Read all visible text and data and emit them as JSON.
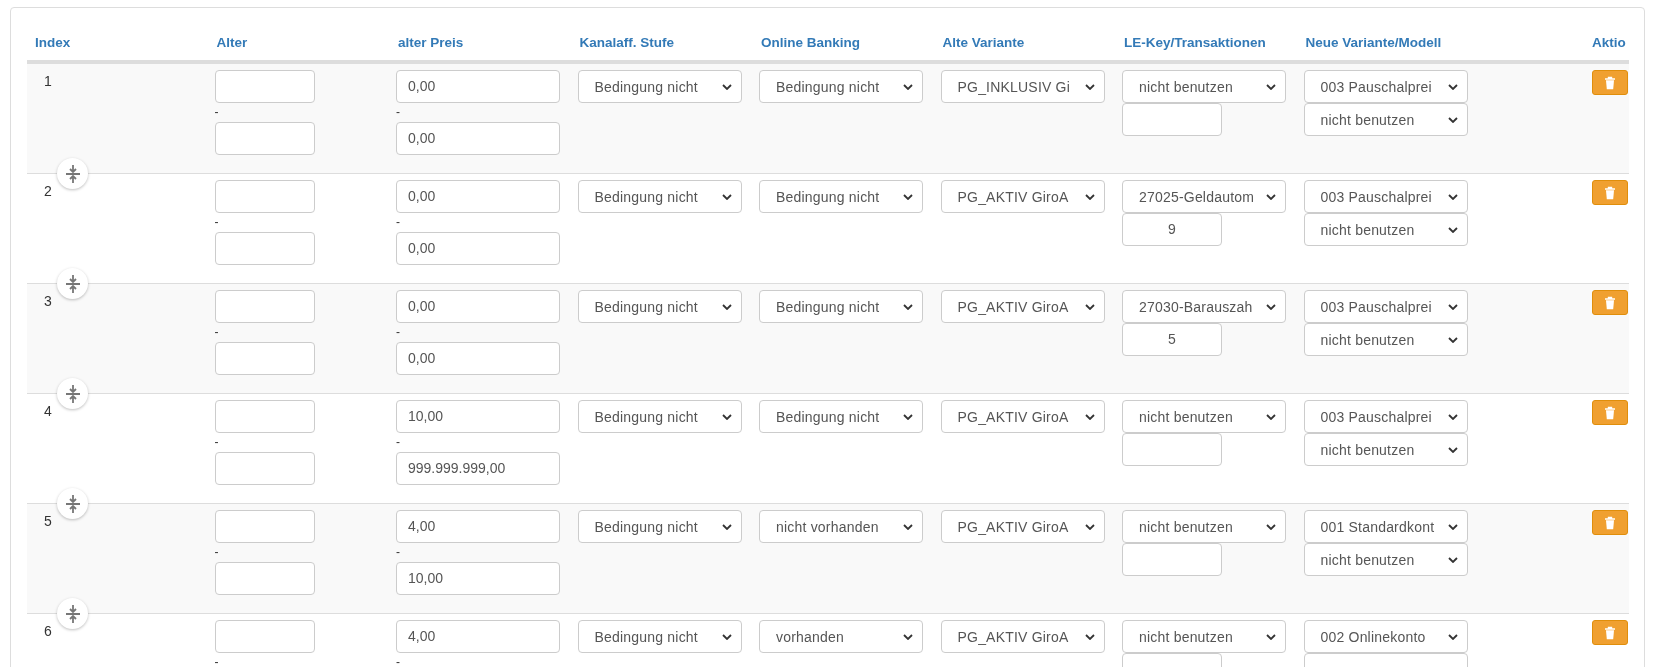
{
  "columns": [
    "Index",
    "Alter",
    "alter Preis",
    "Kanalaff. Stufe",
    "Online Banking",
    "Alte Variante",
    "LE-Key/Transaktionen",
    "Neue Variante/Modell",
    "Aktio"
  ],
  "rows": [
    {
      "index": "1",
      "alter_sep": "-",
      "preis_sep": "-",
      "preis_from": "0,00",
      "preis_to": "0,00",
      "kanalaff": "Bedingung nicht",
      "online_banking": "Bedingung nicht",
      "alte_variante": "PG_INKLUSIV Gi",
      "le_key": "nicht benutzen",
      "neue_variante": "003 Pauschalprei",
      "modell": "nicht benutzen"
    },
    {
      "index": "2",
      "alter_sep": "-",
      "preis_sep": "-",
      "preis_from": "0,00",
      "preis_to": "0,00",
      "kanalaff": "Bedingung nicht",
      "online_banking": "Bedingung nicht",
      "alte_variante": "PG_AKTIV GiroA",
      "le_key": "27025-Geldautom",
      "transaktionen": "9",
      "neue_variante": "003 Pauschalprei",
      "modell": "nicht benutzen"
    },
    {
      "index": "3",
      "alter_sep": "-",
      "preis_sep": "-",
      "preis_from": "0,00",
      "preis_to": "0,00",
      "kanalaff": "Bedingung nicht",
      "online_banking": "Bedingung nicht",
      "alte_variante": "PG_AKTIV GiroA",
      "le_key": "27030-Barauszah",
      "transaktionen": "5",
      "neue_variante": "003 Pauschalprei",
      "modell": "nicht benutzen"
    },
    {
      "index": "4",
      "alter_sep": "-",
      "preis_sep": "-",
      "preis_from": "10,00",
      "preis_to": "999.999.999,00",
      "kanalaff": "Bedingung nicht",
      "online_banking": "Bedingung nicht",
      "alte_variante": "PG_AKTIV GiroA",
      "le_key": "nicht benutzen",
      "neue_variante": "003 Pauschalprei",
      "modell": "nicht benutzen"
    },
    {
      "index": "5",
      "alter_sep": "-",
      "preis_sep": "-",
      "preis_from": "4,00",
      "preis_to": "10,00",
      "kanalaff": "Bedingung nicht",
      "online_banking": "nicht vorhanden",
      "alte_variante": "PG_AKTIV GiroA",
      "le_key": "nicht benutzen",
      "neue_variante": "001 Standardkont",
      "modell": "nicht benutzen"
    },
    {
      "index": "6",
      "alter_sep": "-",
      "preis_sep": "-",
      "preis_from": "4,00",
      "kanalaff": "Bedingung nicht",
      "online_banking": "vorhanden",
      "alte_variante": "PG_AKTIV GiroA",
      "le_key": "nicht benutzen",
      "neue_variante": "002 Onlinekonto"
    }
  ]
}
